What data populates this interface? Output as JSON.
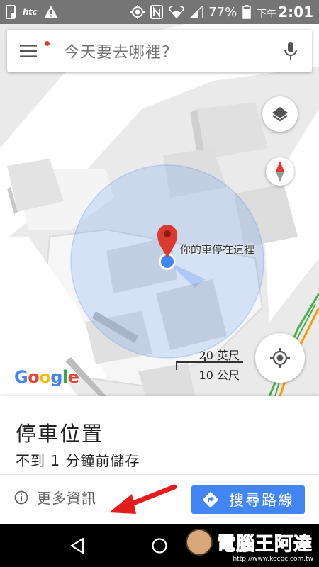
{
  "status_bar": {
    "carrier": "htc",
    "battery": "77%",
    "ampm": "下午",
    "time": "2:01"
  },
  "search": {
    "placeholder": "今天要去哪裡？"
  },
  "map": {
    "pin_label": "你的車停在這裡",
    "logo": "Google",
    "scale_top": "20 英尺",
    "scale_bottom": "10 公尺",
    "accent": "#4285f4",
    "pin_color": "#db3a2f"
  },
  "sheet": {
    "title": "停車位置",
    "subtitle": "不到 1 分鐘前儲存",
    "more_info": "更多資訊",
    "directions": "搜尋路線"
  },
  "watermark": {
    "text": "電腦王阿達",
    "url": "http://www.kocpc.com.tw"
  },
  "icons": [
    "menu-icon",
    "mic-icon",
    "layers-icon",
    "compass-icon",
    "my-location-icon",
    "info-icon",
    "directions-icon",
    "back-icon",
    "home-icon",
    "recents-icon"
  ]
}
